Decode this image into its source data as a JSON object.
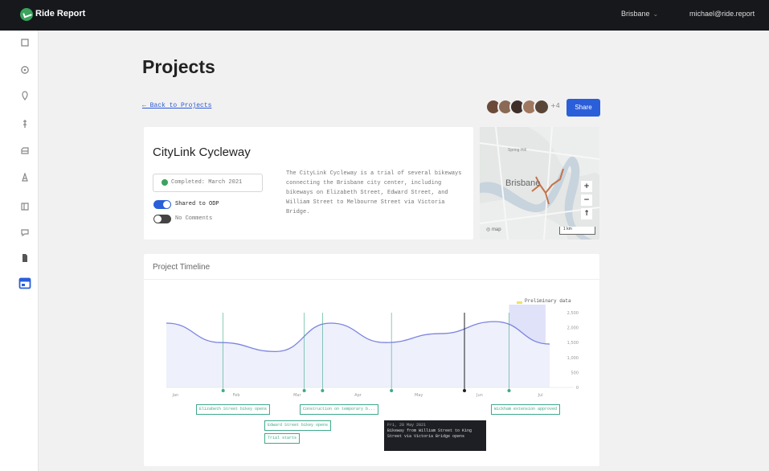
{
  "app": {
    "name": "Ride Report",
    "city": "Brisbane",
    "user": "michael@ride.report"
  },
  "sidebar": {
    "icons": [
      "cube-icon",
      "target-icon",
      "pin-icon",
      "route-icon",
      "vehicle-icon",
      "bike-icon",
      "map-icon",
      "chat-icon",
      "document-icon",
      "calendar-icon"
    ],
    "active": "calendar-icon"
  },
  "page": {
    "title": "Projects",
    "back_link": "← Back to Projects",
    "share_label": "Share"
  },
  "collaborators": {
    "more": "+4"
  },
  "project": {
    "name": "CityLink Cycleway",
    "status": "Completed: March 2021",
    "toggles": [
      {
        "label": "Shared to ODP",
        "on": true
      },
      {
        "label": "No Comments",
        "on": false
      }
    ],
    "description": "The CityLink Cycleway is a trial of several bikeways connecting the Brisbane city center, including bikeways on Elizabeth Street, Edward Street, and William Street to Melbourne Street via Victoria Bridge."
  },
  "map": {
    "labels": {
      "city": "Brisbane",
      "suburb": "Spring Hill",
      "scale": "1 km"
    },
    "controls": [
      "+",
      "−",
      "↑"
    ]
  },
  "timeline": {
    "title": "Project Timeline",
    "legend": "Preliminary data",
    "annotations": [
      "Elizabeth Street bikey opens",
      "Edward Street bikey opens",
      "Trial starts",
      "Construction on temporary b...",
      "Wickham extension approved"
    ],
    "tooltip": {
      "date": "Fri, 28 May 2021",
      "text": "Bikeway from William Street to King Street via Victoria Bridge opens"
    }
  },
  "chart_data": {
    "type": "line",
    "x": [
      "Jan",
      "Feb",
      "Mar",
      "Apr",
      "May",
      "Jun",
      "Jul"
    ],
    "y_ticks": [
      0,
      500,
      1000,
      1500,
      2000,
      2500
    ],
    "ylim": [
      0,
      2500
    ],
    "series": [
      {
        "values": [
          2150,
          1500,
          1200,
          2150,
          1500,
          1800,
          2200,
          1450
        ]
      }
    ],
    "preliminary_range": [
      "Jun 20",
      "Jul 8"
    ],
    "events": [
      "Jan 29",
      "Mar 9",
      "Mar 18",
      "Apr 22",
      "May 28",
      "Jun 20"
    ]
  }
}
